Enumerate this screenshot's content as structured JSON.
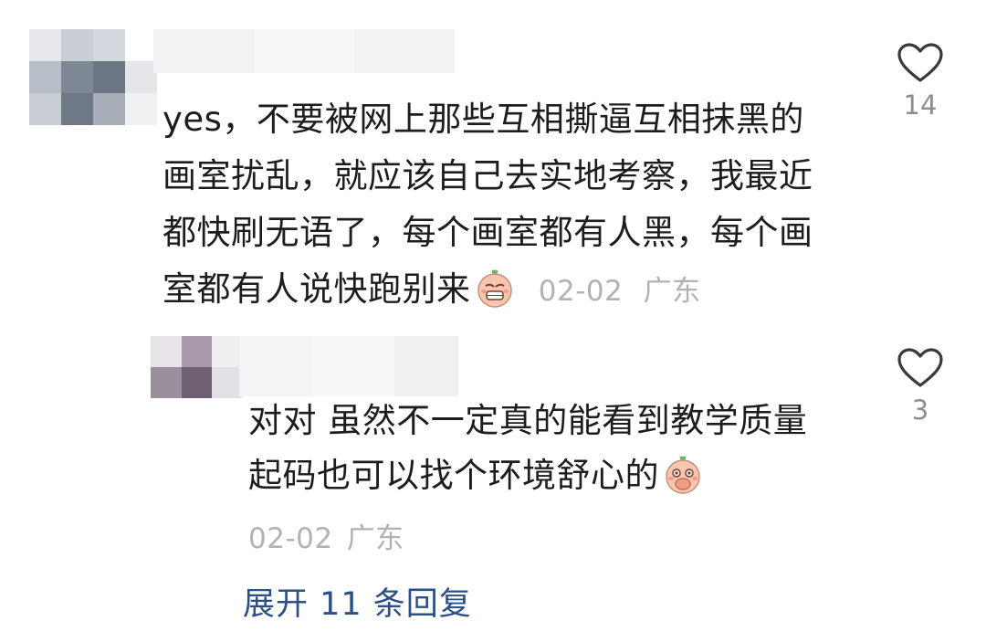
{
  "comment": {
    "lines": [
      "yes，不要被网上那些互相撕逼互相抹黑的",
      "画室扰乱，就应该自己去实地考察，我最近",
      "都快刷无语了，每个画室都有人黑，每个画",
      "室都有人说快跑别来"
    ],
    "date": "02-02",
    "location": "广东",
    "likes": "14",
    "emoji_icon": "tired-peach-emoji-icon"
  },
  "reply": {
    "lines": [
      "对对 虽然不一定真的能看到教学质量",
      "起码也可以找个环境舒心的"
    ],
    "date": "02-02",
    "location": "广东",
    "likes": "3",
    "emoji_icon": "cover-mouth-peach-emoji-icon"
  },
  "expand_replies": {
    "label": "展开 11 条回复"
  },
  "colors": {
    "text": "#1d1d1f",
    "meta": "#b2b2b2",
    "link": "#2c4f87",
    "like_icon": "#3a3a3a"
  }
}
